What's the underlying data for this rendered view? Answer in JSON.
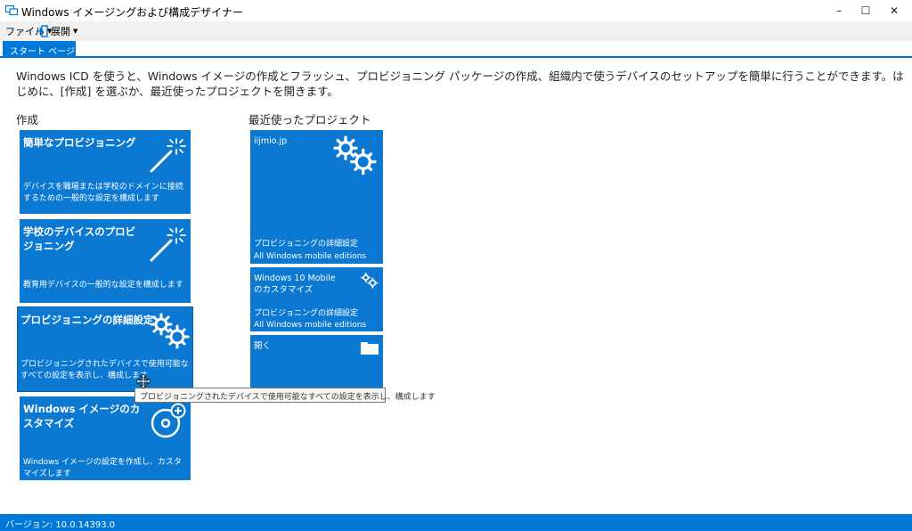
{
  "window": {
    "title": "Windows イメージングおよび構成デザイナー",
    "minimize": "–",
    "maximize": "☐",
    "close": "✕"
  },
  "menu": {
    "file": "ファイル",
    "expand": "展開"
  },
  "tabs": [
    {
      "label": "スタート ページ",
      "active": true
    }
  ],
  "intro": "Windows ICD を使うと、Windows イメージの作成とフラッシュ、プロビジョニング パッケージの作成、組織内で使うデバイスのセットアップを簡単に行うことができます。はじめに、[作成] を選ぶか、最近使ったプロジェクトを開きます。",
  "create": {
    "heading": "作成",
    "tiles": [
      {
        "title": "簡単なプロビジョニング",
        "description": "デバイスを職場または学校のドメインに接続するための一般的な設定を構成します",
        "icon": "magic-wand-icon"
      },
      {
        "title": "学校のデバイスのプロビジョニング",
        "description": "教育用デバイスの一般的な設定を構成します",
        "icon": "magic-wand-icon"
      },
      {
        "title": "プロビジョニングの詳細設定",
        "description": "プロビジョニングされたデバイスで使用可能なすべての設定を表示し、構成します",
        "icon": "gears-icon"
      },
      {
        "title": "Windows イメージのカスタマイズ",
        "description": "Windows イメージの設定を作成し、カスタマイズします",
        "icon": "disc-add-icon"
      }
    ]
  },
  "recent": {
    "heading": "最近使ったプロジェクト",
    "tiles": [
      {
        "name": "iijmio.jp",
        "type": "プロビジョニングの詳細設定",
        "edition": "All Windows mobile editions",
        "icon": "gears-icon"
      },
      {
        "name": "Windows 10 Mobileのカスタマイズ",
        "type": "プロビジョニングの詳細設定",
        "edition": "All Windows mobile editions",
        "icon": "gears-icon"
      },
      {
        "name": "開く",
        "icon": "folder-icon"
      }
    ]
  },
  "tooltip": "プロビジョニングされたデバイスで使用可能なすべての設定を表示し、構成します",
  "status": "バージョン: 10.0.14393.0",
  "colors": {
    "accent": "#0078d7",
    "tile": "#0b78d1",
    "menubar": "#f0f0f0"
  }
}
